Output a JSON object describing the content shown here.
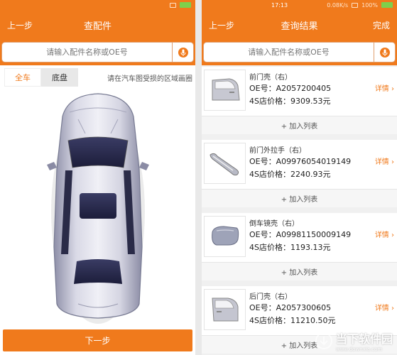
{
  "left": {
    "status": {
      "time": ""
    },
    "nav": {
      "back": "上一步",
      "title": "查配件"
    },
    "search": {
      "placeholder": "请输入配件名称或OE号"
    },
    "tabs": [
      {
        "label": "全车"
      },
      {
        "label": "底盘"
      }
    ],
    "hint": "请在汽车图受损的区域画圈",
    "next_button": "下一步"
  },
  "right": {
    "status": {
      "time": "17:13",
      "speed": "0.08K/s",
      "battery": "100%"
    },
    "nav": {
      "back": "上一步",
      "title": "查询结果",
      "done": "完成"
    },
    "search": {
      "placeholder": "请输入配件名称或OE号"
    },
    "results": [
      {
        "name": "前门壳（右）",
        "oe": "OE号：A2057200405",
        "price": "4S店价格：9309.53元",
        "detail": "详情",
        "add": "+ 加入列表",
        "icon": "door-panel-icon"
      },
      {
        "name": "前门外拉手（右）",
        "oe": "OE号：A09976054019149",
        "price": "4S店价格：2240.93元",
        "detail": "详情",
        "add": "+ 加入列表",
        "icon": "door-handle-icon"
      },
      {
        "name": "倒车镜壳（右）",
        "oe": "OE号：A09981150009149",
        "price": "4S店价格：1193.13元",
        "detail": "详情",
        "add": "+ 加入列表",
        "icon": "mirror-cover-icon"
      },
      {
        "name": "后门壳（右）",
        "oe": "OE号：A2057300605",
        "price": "4S店价格：11210.50元",
        "detail": "详情",
        "add": "+ 加入列表",
        "icon": "rear-door-icon"
      }
    ]
  },
  "watermark": {
    "text": "当下软件园",
    "url": "www.downxia.com"
  },
  "colors": {
    "accent": "#f07a1c",
    "background": "#ffffff",
    "divider": "#f0f0f0"
  }
}
